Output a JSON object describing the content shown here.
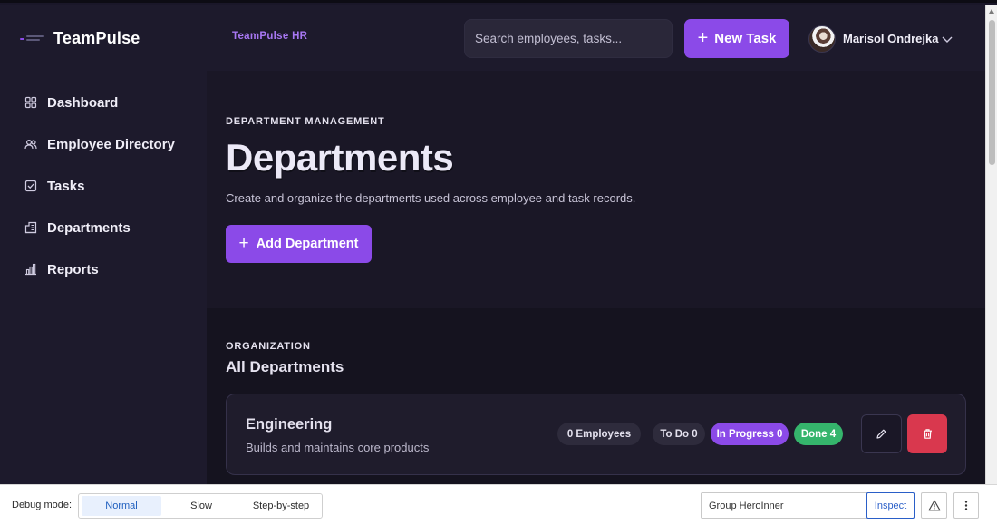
{
  "header": {
    "brand": "TeamPulse",
    "sub_brand": "TeamPulse HR",
    "search_placeholder": "Search employees, tasks...",
    "new_task_label": "New Task",
    "user_name": "Marisol Ondrejka"
  },
  "sidebar": {
    "items": [
      {
        "label": "Dashboard",
        "icon": "grid-icon"
      },
      {
        "label": "Employee Directory",
        "icon": "users-icon"
      },
      {
        "label": "Tasks",
        "icon": "checkbox-icon"
      },
      {
        "label": "Departments",
        "icon": "building-icon"
      },
      {
        "label": "Reports",
        "icon": "bar-chart-icon"
      }
    ]
  },
  "hero": {
    "eyebrow": "DEPARTMENT MANAGEMENT",
    "title": "Departments",
    "description": "Create and organize the departments used across employee and task records.",
    "add_button_label": "Add Department"
  },
  "departments_section": {
    "eyebrow": "ORGANIZATION",
    "title": "All Departments",
    "items": [
      {
        "name": "Engineering",
        "description": "Builds and maintains core products",
        "employees_label": "0 Employees",
        "todo_label": "To Do 0",
        "in_progress_label": "In Progress 0",
        "done_label": "Done 4"
      }
    ]
  },
  "debug": {
    "label": "Debug mode:",
    "modes": [
      "Normal",
      "Slow",
      "Step-by-step"
    ],
    "active_mode": "Normal",
    "group_value": "Group HeroInner",
    "inspect_label": "Inspect"
  },
  "colors": {
    "accent": "#8b4ae8",
    "done": "#35b56c",
    "danger": "#d9384e",
    "sub_brand": "#a777f2"
  }
}
